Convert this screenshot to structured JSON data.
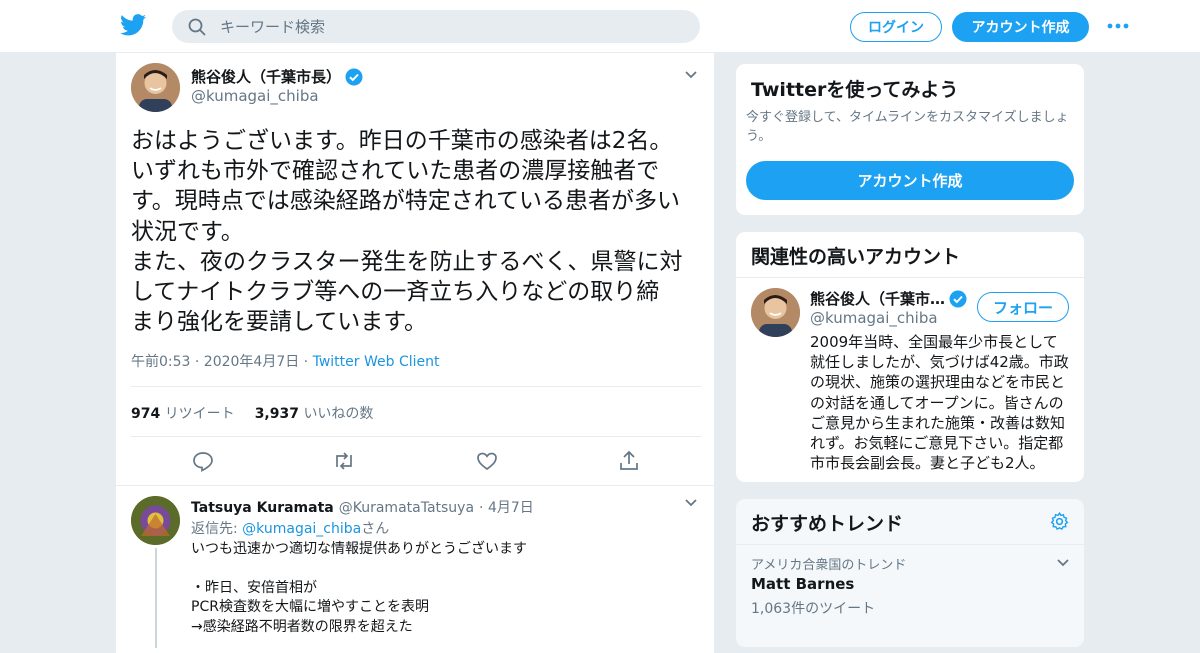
{
  "topbar": {
    "search_placeholder": "キーワード検索",
    "login_label": "ログイン",
    "signup_label": "アカウント作成"
  },
  "tweet": {
    "author_name": "熊谷俊人（千葉市長）",
    "author_handle": "@kumagai_chiba",
    "text": "おはようございます。昨日の千葉市の感染者は2名。\nいずれも市外で確認されていた患者の濃厚接触者で\nす。現時点では感染経路が特定されている患者が多い\n状況です。\nまた、夜のクラスター発生を防止するべく、県警に対\nしてナイトクラブ等への一斉立ち入りなどの取り締\nまり強化を要請しています。",
    "time": "午前0:53 · 2020年4月7日 · ",
    "source": "Twitter Web Client",
    "retweet_count": "974",
    "retweet_label": "リツイート",
    "like_count": "3,937",
    "like_label": "いいねの数"
  },
  "reply": {
    "name": "Tatsuya Kuramata",
    "handle": "@KuramataTatsuya",
    "date": "· 4月7日",
    "reply_to_prefix": "返信先: ",
    "reply_to_handle": "@kumagai_chiba",
    "reply_to_suffix": "さん",
    "text": "いつも迅速かつ適切な情報提供ありがとうございます\n\n・昨日、安倍首相が\n  PCR検査数を大幅に増やすことを表明\n  →感染経路不明者数の限界を超えた"
  },
  "sidebar": {
    "try": {
      "title": "Twitterを使ってみよう",
      "subtitle": "今すぐ登録して、タイムラインをカスタマイズしましょう。",
      "button": "アカウント作成"
    },
    "related": {
      "title": "関連性の高いアカウント",
      "name": "熊谷俊人（千葉市…",
      "handle": "@kumagai_chiba",
      "follow_label": "フォロー",
      "bio": "2009年当時、全国最年少市長として就任しましたが、気づけば42歳。市政の現状、施策の選択理由などを市民との対話を通してオープンに。皆さんのご意見から生まれた施策・改善は数知れず。お気軽にご意見下さい。指定都市市長会副会長。妻と子ども2人。"
    },
    "trends": {
      "title": "おすすめトレンド",
      "item_context": "アメリカ合衆国のトレンド",
      "item_name": "Matt Barnes",
      "item_count": "1,063件のツイート"
    }
  },
  "colors": {
    "accent": "#1da1f2",
    "link": "#1b95e0",
    "muted": "#657786",
    "verified": "#1da1f2"
  },
  "icons": [
    "twitter-logo-icon",
    "search-icon",
    "more-icon",
    "verified-icon",
    "chevron-down-icon",
    "reply-icon",
    "retweet-icon",
    "like-icon",
    "share-icon",
    "settings-icon"
  ]
}
